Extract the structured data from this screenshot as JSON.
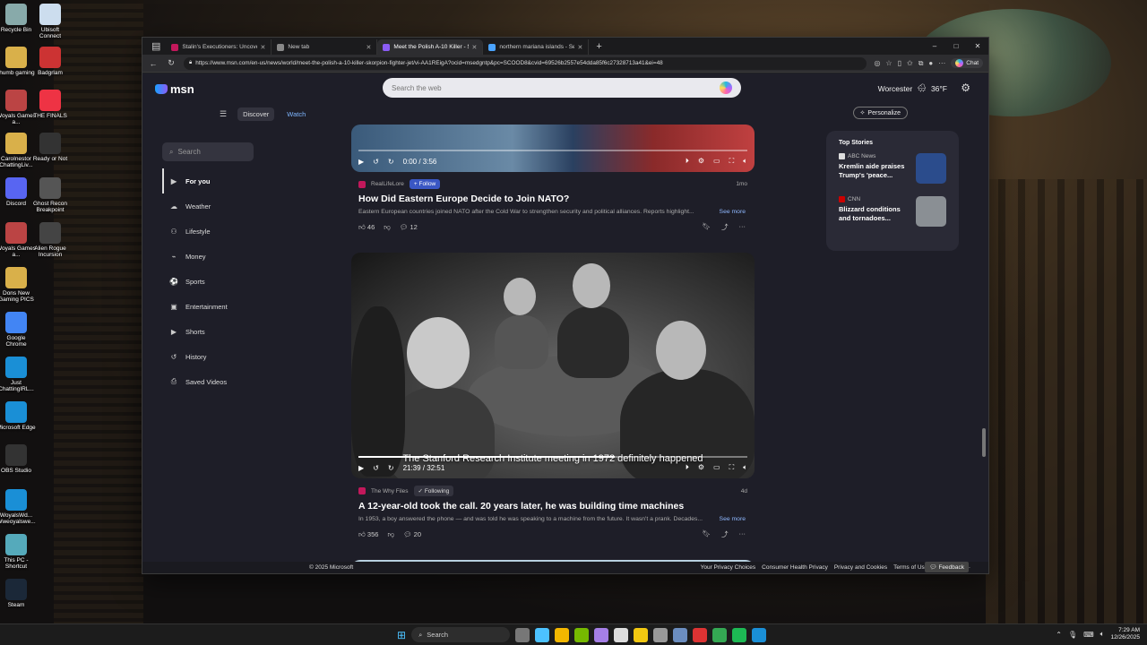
{
  "desktop": {
    "icons": [
      {
        "label": "Recycle Bin",
        "color": "#8aa"
      },
      {
        "label": "Ubisoft Connect",
        "color": "#cde"
      },
      {
        "label": "thumb gaming",
        "color": "#d9b04a"
      },
      {
        "label": "Badgrlam",
        "color": "#c33"
      },
      {
        "label": "Woyals Games a...",
        "color": "#b44"
      },
      {
        "label": "THE FINALS",
        "color": "#e34"
      },
      {
        "label": "CaroInestor ChattingLiv...",
        "color": "#d9b04a"
      },
      {
        "label": "Ready or Not",
        "color": "#333"
      },
      {
        "label": "Discord",
        "color": "#5865f2"
      },
      {
        "label": "Ghost Recon Breakpoint",
        "color": "#555"
      },
      {
        "label": "Woyals Games a...",
        "color": "#b44"
      },
      {
        "label": "Alien Rogue Incursion",
        "color": "#444"
      },
      {
        "label": "Dons New Gaming PICS",
        "color": "#d9b04a"
      },
      {
        "label": "Google Chrome",
        "color": "#4285f4"
      },
      {
        "label": "Just ChattingIRL...",
        "color": "#1a8fd6"
      },
      {
        "label": "Microsoft Edge",
        "color": "#1a8fd6"
      },
      {
        "label": "OBS Studio",
        "color": "#333"
      },
      {
        "label": "WoyalsWd... Wweoyalswe...",
        "color": "#1a8fd6"
      },
      {
        "label": "This PC - Shortcut",
        "color": "#5ab"
      },
      {
        "label": "Steam",
        "color": "#1b2838"
      }
    ]
  },
  "browser": {
    "tabs": [
      {
        "label": "Stalin's Executioners: Uncovering",
        "fav": "#c2185b"
      },
      {
        "label": "New tab",
        "fav": "#888"
      },
      {
        "label": "Meet the Polish A-10 Killer - Skor",
        "fav": "#8b5cf6"
      },
      {
        "label": "northern mariana islands - Search",
        "fav": "#4aa3ff"
      }
    ],
    "active_tab": 2,
    "new_tab": "+",
    "window_controls": {
      "minimize": "–",
      "maximize": "□",
      "close": "✕"
    },
    "url": "https://www.msn.com/en-us/news/world/meet-the-polish-a-10-killer-skorpion-fighter-jet/vi-AA1REigA?ocid=msedgntp&pc=SCOOD8&cvid=69526b2557e54dda85f6c27328713a41&ei=48",
    "chat_label": "Chat"
  },
  "msn": {
    "logo": "msn",
    "search_placeholder": "Search the web",
    "weather": {
      "location": "Worcester",
      "temp": "36°F"
    },
    "subnav": {
      "discover": "Discover",
      "watch": "Watch"
    },
    "personalize": "Personalize",
    "sidebar": {
      "search_placeholder": "Search",
      "items": [
        {
          "label": "For you",
          "icon": "▶"
        },
        {
          "label": "Weather",
          "icon": "☁"
        },
        {
          "label": "Lifestyle",
          "icon": "⚇"
        },
        {
          "label": "Money",
          "icon": "⌁"
        },
        {
          "label": "Sports",
          "icon": "⚽"
        },
        {
          "label": "Entertainment",
          "icon": "▣"
        },
        {
          "label": "Shorts",
          "icon": "▶"
        },
        {
          "label": "History",
          "icon": "↺"
        },
        {
          "label": "Saved Videos",
          "icon": "⎙"
        }
      ]
    },
    "cards": [
      {
        "time": "0:00 / 3:56",
        "progress": 0.0,
        "source": "RealLifeLore",
        "source_color": "#c2185b",
        "follow": "Follow",
        "age": "1mo",
        "headline": "How Did Eastern Europe Decide to Join NATO?",
        "desc": "Eastern European countries joined NATO after the Cold War to strengthen security and political alliances. Reports highlight...",
        "see_more": "See more",
        "likes": "46",
        "comments": "12"
      },
      {
        "time": "21:39 / 32:51",
        "progress": 0.66,
        "caption": "The Stanford Research Institute meeting in 1972 definitely happened",
        "source": "The Why Files",
        "source_color": "#c2185b",
        "following": "Following",
        "age": "4d",
        "headline": "A 12-year-old took the call. 20 years later, he was building time machines",
        "desc": "In 1953, a boy answered the phone — and was told he was speaking to a machine from the future. It wasn't a prank. Decades...",
        "see_more": "See more",
        "likes": "356",
        "comments": "20"
      }
    ],
    "top_stories": {
      "title": "Top Stories",
      "items": [
        {
          "source": "ABC News",
          "title": "Kremlin aide praises Trump's 'peace...",
          "thumb": "#2b4c8c"
        },
        {
          "source": "CNN",
          "title": "Blizzard conditions and tornadoes...",
          "thumb": "#8a8f94"
        }
      ]
    },
    "footer": {
      "copyright": "© 2025 Microsoft",
      "links": [
        "Your Privacy Choices",
        "Consumer Health Privacy",
        "Privacy and Cookies",
        "Terms of Use",
        "Advertise"
      ],
      "more": "···",
      "feedback": "Feedback"
    }
  },
  "taskbar": {
    "search_placeholder": "Search",
    "apps": [
      "#777",
      "#4cc2ff",
      "#f3b700",
      "#76b900",
      "#a57fe6",
      "#ddd",
      "#f2c811",
      "#999",
      "#6b8dbf",
      "#d33",
      "#34a853",
      "#1db954",
      "#1a8fd6"
    ],
    "time": "7:29 AM",
    "date": "12/26/2025"
  }
}
